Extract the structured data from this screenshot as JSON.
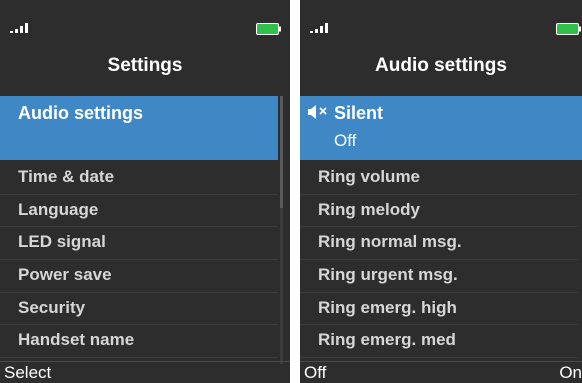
{
  "screens": [
    {
      "title": "Settings",
      "selected": {
        "label": "Audio settings"
      },
      "items": [
        "Time & date",
        "Language",
        "LED signal",
        "Power save",
        "Security",
        "Handset name"
      ],
      "softkeys": {
        "left": "Select"
      }
    },
    {
      "title": "Audio settings",
      "selected": {
        "label": "Silent",
        "value": "Off",
        "icon": "speaker-muted-icon"
      },
      "items": [
        "Ring volume",
        "Ring melody",
        "Ring normal msg.",
        "Ring urgent msg.",
        "Ring emerg. high",
        "Ring emerg. med"
      ],
      "softkeys": {
        "left": "Off",
        "right": "On"
      }
    }
  ],
  "colors": {
    "background": "#2d2d2d",
    "selection": "#3f88c5",
    "battery": "#2fbf4a",
    "text": "#ffffff",
    "item_text": "#d6d6d6"
  },
  "icons": [
    "signal-icon",
    "battery-icon",
    "speaker-muted-icon"
  ]
}
